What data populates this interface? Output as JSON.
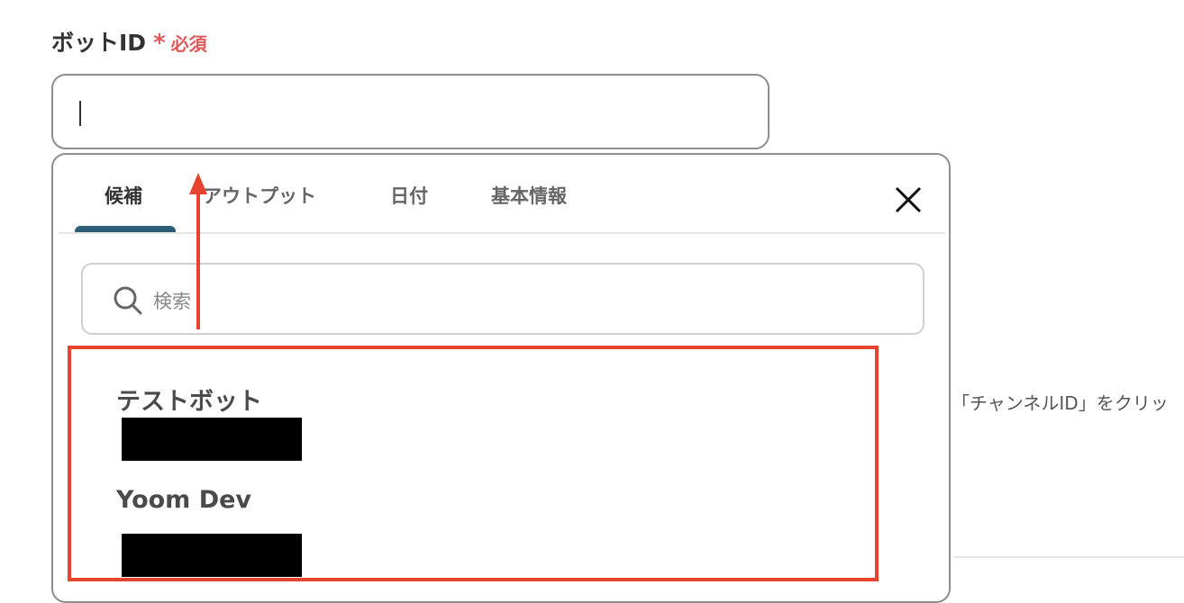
{
  "field": {
    "label": "ボットID",
    "required_asterisk": "*",
    "required_text": "必須",
    "value": ""
  },
  "dropdown": {
    "tabs": [
      {
        "label": "候補",
        "active": true
      },
      {
        "label": "アウトプット",
        "active": false
      },
      {
        "label": "日付",
        "active": false
      },
      {
        "label": "基本情報",
        "active": false
      }
    ],
    "search": {
      "placeholder": "検索",
      "value": ""
    },
    "candidates": [
      {
        "name": "テストボット",
        "id_redacted": true
      },
      {
        "name": "Yoom Dev",
        "id_redacted": true
      }
    ]
  },
  "side_hint": "「チャンネルID」をクリッ",
  "colors": {
    "required": "#e05a5a",
    "tab_underline": "#2e5d78",
    "annotation": "#e5442f"
  }
}
